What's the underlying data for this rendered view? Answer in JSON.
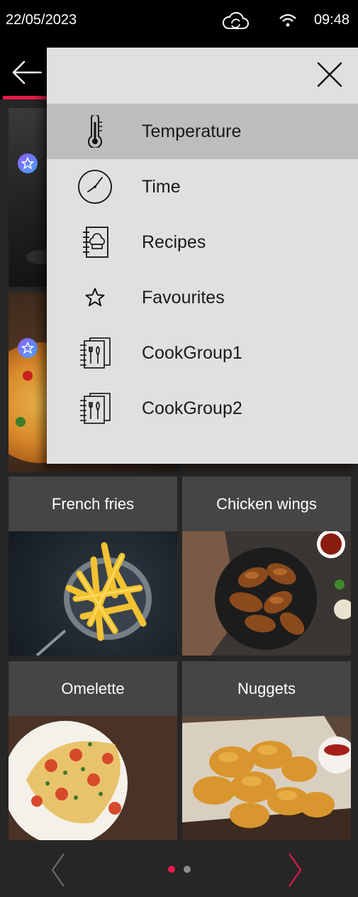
{
  "status_bar": {
    "date": "22/05/2023",
    "time": "09:48",
    "cloud_icon": "cloud-sync-icon",
    "wifi_icon": "wifi-icon"
  },
  "header": {
    "back_icon": "arrow-left-icon",
    "accent_color": "#e6194b"
  },
  "menu": {
    "close_icon": "close-icon",
    "items": [
      {
        "label": "Temperature",
        "icon": "thermometer-icon",
        "selected": true
      },
      {
        "label": "Time",
        "icon": "clock-icon"
      },
      {
        "label": "Recipes",
        "icon": "recipe-book-icon"
      },
      {
        "label": "Favourites",
        "icon": "star-icon"
      },
      {
        "label": "CookGroup1",
        "icon": "cook-group-icon"
      },
      {
        "label": "CookGroup2",
        "icon": "cook-group-icon"
      }
    ]
  },
  "tiles": [
    {
      "name": "French fries"
    },
    {
      "name": "Chicken wings"
    },
    {
      "name": "Omelette"
    },
    {
      "name": "Nuggets"
    }
  ],
  "pager": {
    "prev_icon": "chevron-left-icon",
    "next_icon": "chevron-right-icon",
    "current_page": 1,
    "page_count": 2,
    "active_color": "#e6194b",
    "inactive_color": "#8c8c8c"
  }
}
